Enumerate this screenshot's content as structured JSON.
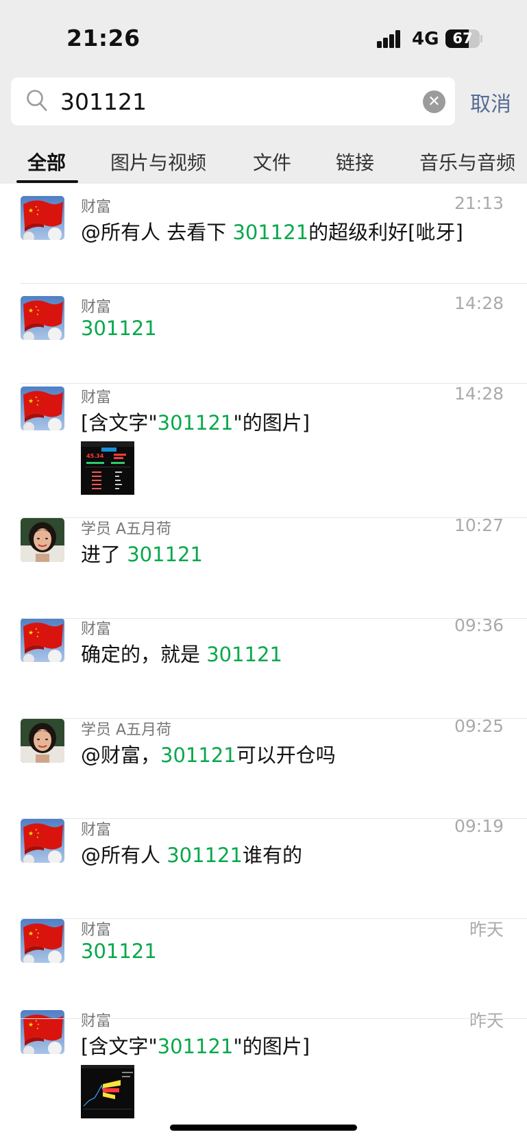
{
  "status": {
    "time": "21:26",
    "network": "4G",
    "battery": "67",
    "battery_level": 0.67
  },
  "search": {
    "query": "301121",
    "cancel_label": "取消"
  },
  "tabs": [
    {
      "label": "全部",
      "active": true
    },
    {
      "label": "图片与视频",
      "active": false
    },
    {
      "label": "文件",
      "active": false
    },
    {
      "label": "链接",
      "active": false
    },
    {
      "label": "音乐与音频",
      "active": false
    }
  ],
  "colors": {
    "highlight": "#07a84a",
    "link": "#576b95"
  },
  "results": [
    {
      "avatar": "flag",
      "sender": "财富",
      "time": "21:13",
      "pre": "@所有人 去看下 ",
      "hl": "301121",
      "post": "的超级利好[呲牙]"
    },
    {
      "avatar": "flag",
      "sender": "财富",
      "time": "14:28",
      "pre": "",
      "hl": "301121",
      "post": ""
    },
    {
      "avatar": "flag",
      "sender": "财富",
      "time": "14:28",
      "pre": "[含文字\"",
      "hl": "301121",
      "post": "\"的图片]",
      "thumb": "stock-quote-thumbnail"
    },
    {
      "avatar": "woman",
      "sender": "学员 A五月荷",
      "time": "10:27",
      "pre": "进了 ",
      "hl": "301121",
      "post": ""
    },
    {
      "avatar": "flag",
      "sender": "财富",
      "time": "09:36",
      "pre": "确定的，就是 ",
      "hl": "301121",
      "post": ""
    },
    {
      "avatar": "woman",
      "sender": "学员 A五月荷",
      "time": "09:25",
      "pre": "@财富，",
      "hl": "301121",
      "post": "可以开仓吗"
    },
    {
      "avatar": "flag",
      "sender": "财富",
      "time": "09:19",
      "pre": "@所有人 ",
      "hl": "301121",
      "post": "谁有的"
    },
    {
      "avatar": "flag",
      "sender": "财富",
      "time": "昨天",
      "pre": "",
      "hl": "301121",
      "post": ""
    },
    {
      "avatar": "flag",
      "sender": "财富",
      "time": "昨天",
      "pre": "[含文字\"",
      "hl": "301121",
      "post": "\"的图片]",
      "thumb": "stock-chart-thumbnail"
    }
  ]
}
